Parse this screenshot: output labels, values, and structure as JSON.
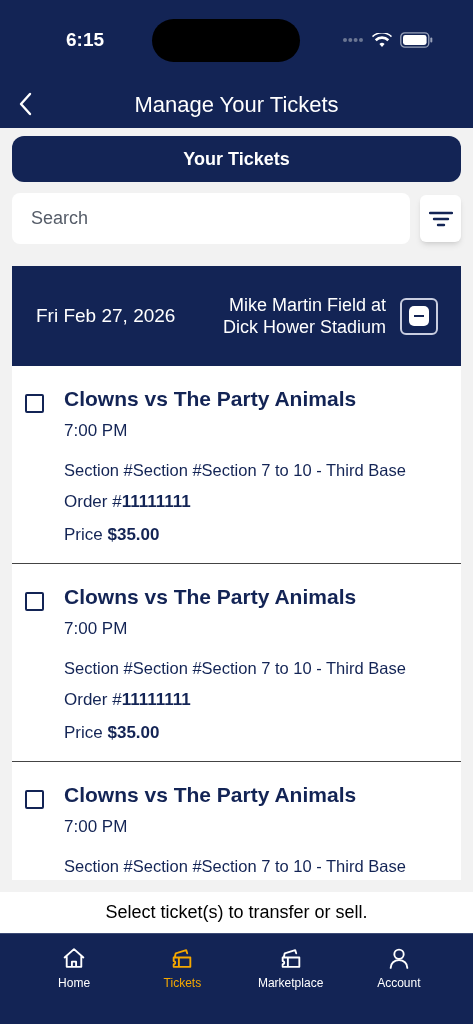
{
  "status_bar": {
    "time": "6:15"
  },
  "nav": {
    "title": "Manage Your Tickets"
  },
  "segment": {
    "label": "Your Tickets"
  },
  "search": {
    "placeholder": "Search"
  },
  "group": {
    "date": "Fri Feb 27, 2026",
    "venue": "Mike Martin Field at Dick Hower Stadium",
    "expanded": true
  },
  "tickets": [
    {
      "title": "Clowns vs The Party Animals",
      "time": "7:00 PM",
      "section": "Section #Section #Section 7 to 10 - Third Base",
      "order": "Order #**11111111**",
      "price": "Price **$35.00**",
      "checked": false
    },
    {
      "title": "Clowns vs The Party Animals",
      "time": "7:00 PM",
      "section": "Section #Section #Section 7 to 10 - Third Base",
      "order": "Order #**11111111**",
      "price": "Price **$35.00**",
      "checked": false
    },
    {
      "title": "Clowns vs The Party Animals",
      "time": "7:00 PM",
      "section": "Section #Section #Section 7 to 10 - Third Base",
      "checked": false
    }
  ],
  "hint": "Select ticket(s) to transfer or sell.",
  "tab_bar": [
    {
      "label": "Home",
      "kind": "home",
      "selected": false
    },
    {
      "label": "Tickets",
      "kind": "tickets",
      "selected": true
    },
    {
      "label": "Marketplace",
      "kind": "marketplace",
      "selected": false
    },
    {
      "label": "Account",
      "kind": "account",
      "selected": false
    }
  ]
}
